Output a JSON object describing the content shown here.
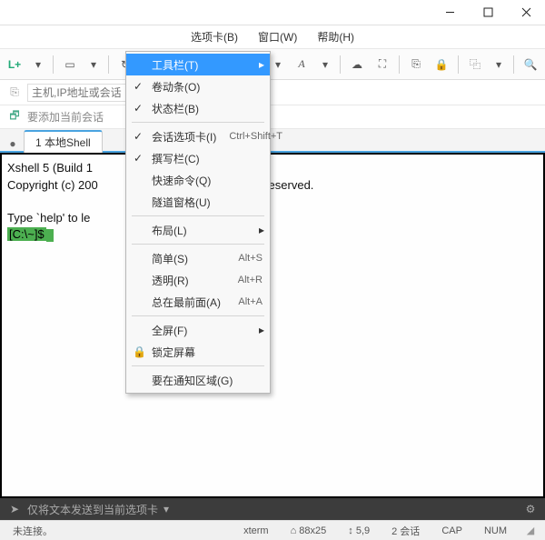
{
  "titlebar": {
    "title": ""
  },
  "menubar": {
    "tabs": "选项卡(B)",
    "window": "窗口(W)",
    "help": "帮助(H)"
  },
  "toolbar": {
    "new": "L+"
  },
  "address": {
    "label": "主机,IP地址或会话",
    "placeholder": "主机,IP地址或会话"
  },
  "addrow2": {
    "label": "要添加当前会话"
  },
  "tabs": {
    "items": [
      {
        "label": "1 本地Shell",
        "active": true
      }
    ]
  },
  "dropdown": {
    "items": [
      {
        "key": "toolbar",
        "label": "工具栏(T)",
        "submenu": true,
        "highlight": true
      },
      {
        "key": "scrollbar",
        "label": "卷动条(O)",
        "checked": true
      },
      {
        "key": "statusbar",
        "label": "状态栏(B)",
        "checked": true
      },
      {
        "sep": true
      },
      {
        "key": "sessiontab",
        "label": "会话选项卡(I)",
        "checked": true,
        "shortcut": "Ctrl+Shift+T"
      },
      {
        "key": "compose",
        "label": "撰写栏(C)",
        "checked": true
      },
      {
        "key": "quickcmd",
        "label": "快速命令(Q)"
      },
      {
        "key": "tunnel",
        "label": "隧道窗格(U)"
      },
      {
        "sep": true
      },
      {
        "key": "layout",
        "label": "布局(L)",
        "submenu": true
      },
      {
        "sep": true
      },
      {
        "key": "simple",
        "label": "简单(S)",
        "shortcut": "Alt+S"
      },
      {
        "key": "transp",
        "label": "透明(R)",
        "shortcut": "Alt+R"
      },
      {
        "key": "topmost",
        "label": "总在最前面(A)",
        "shortcut": "Alt+A"
      },
      {
        "sep": true
      },
      {
        "key": "fullscreen",
        "label": "全屏(F)",
        "submenu": true
      },
      {
        "key": "lock",
        "label": "锁定屏幕",
        "lock": true
      },
      {
        "sep": true
      },
      {
        "key": "tray",
        "label": "要在通知区域(G)"
      }
    ]
  },
  "terminal": {
    "line1": "Xshell 5 (Build 1",
    "line2_a": "Copyright (c) 200",
    "line2_b": "c. All rights reserved.",
    "line3": "Type `help' to le",
    "prompt": "[C:\\~]$"
  },
  "sendbar": {
    "text": "仅将文本发送到当前选项卡"
  },
  "statusbar": {
    "conn": "未连接。",
    "term": "xterm",
    "size_icon": "⌂",
    "size": "88x25",
    "pos_icon": "↕",
    "pos": "5,9",
    "sessions": "2 会话",
    "cap": "CAP",
    "num": "NUM"
  }
}
